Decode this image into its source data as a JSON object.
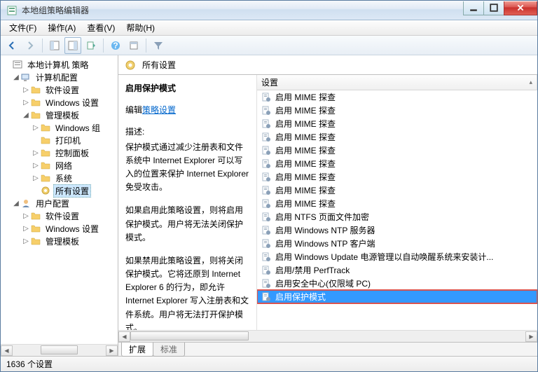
{
  "window": {
    "title": "本地组策略编辑器"
  },
  "menu": {
    "file": "文件(F)",
    "action": "操作(A)",
    "view": "查看(V)",
    "help": "帮助(H)"
  },
  "tree": {
    "root": "本地计算机 策略",
    "computer_config": "计算机配置",
    "software_settings": "软件设置",
    "windows_settings": "Windows 设置",
    "admin_templates": "管理模板",
    "windows_comp": "Windows 组",
    "printers": "打印机",
    "control_panel": "控制面板",
    "network": "网络",
    "system": "系统",
    "all_settings": "所有设置",
    "user_config": "用户配置",
    "u_software": "软件设置",
    "u_windows": "Windows 设置",
    "u_admin": "管理模板"
  },
  "right": {
    "header": "所有设置",
    "desc_title": "启用保护模式",
    "edit_prefix": "编辑",
    "edit_link": "策略设置",
    "desc_label": "描述:",
    "desc_p1": "保护模式通过减少注册表和文件系统中 Internet Explorer 可以写入的位置来保护 Internet Explorer 免受攻击。",
    "desc_p2": "如果启用此策略设置，则将启用保护模式。用户将无法关闭保护模式。",
    "desc_p3": "如果禁用此策略设置，则将关闭保护模式。它将还原到 Internet Explorer 6 的行为，即允许 Internet Explorer 写入注册表和文件系统。用户将无法打开保护模式。",
    "col_setting": "设置",
    "items": [
      "启用 MIME 探查",
      "启用 MIME 探查",
      "启用 MIME 探查",
      "启用 MIME 探查",
      "启用 MIME 探查",
      "启用 MIME 探查",
      "启用 MIME 探查",
      "启用 MIME 探查",
      "启用 MIME 探查",
      "启用 NTFS 页面文件加密",
      "启用 Windows NTP 服务器",
      "启用 Windows NTP 客户端",
      "启用 Windows Update 电源管理以自动唤醒系统来安装计...",
      "启用/禁用 PerfTrack",
      "启用安全中心(仅限域 PC)",
      "启用保护模式"
    ],
    "tab_ext": "扩展",
    "tab_std": "标准"
  },
  "status": {
    "text": "1636 个设置"
  }
}
